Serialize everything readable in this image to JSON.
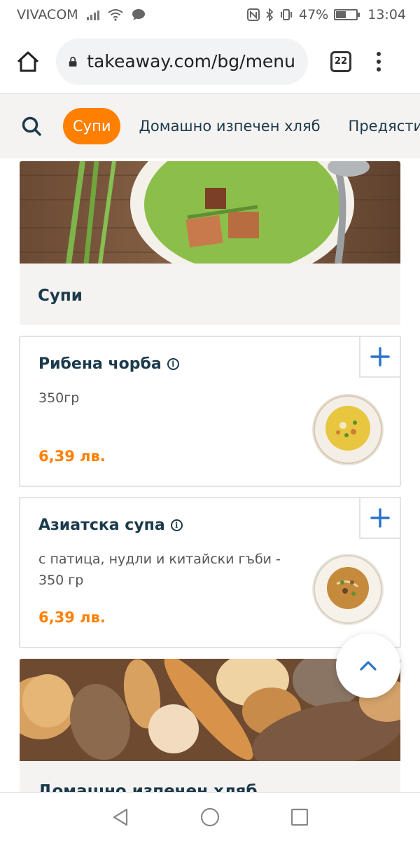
{
  "status_bar": {
    "carrier": "VIVACOM",
    "battery_percent_text": "47%",
    "battery_level": 0.47,
    "time": "13:04"
  },
  "browser": {
    "url": "takeaway.com/bg/menu",
    "tab_count": "22"
  },
  "category_nav": {
    "active": "Супи",
    "items": [
      "Домашно изпечен хляб",
      "Предястия"
    ]
  },
  "section_soups": {
    "title": "Супи"
  },
  "items": [
    {
      "name": "Рибена чорба",
      "description": "350гр",
      "price": "6,39 лв."
    },
    {
      "name": "Азиатска супа",
      "description": "с патица, нудли и китайски гъби - 350 гр",
      "price": "6,39 лв."
    }
  ],
  "section_bread": {
    "title": "Домашно изпечен хляб"
  },
  "colors": {
    "accent": "#ff8000",
    "text_dark": "#1b3a4b",
    "add_icon": "#2a73c9",
    "panel_bg": "#f5f3f1"
  },
  "icons": [
    "home-icon",
    "lock-icon",
    "search-icon",
    "plus-icon",
    "info-icon",
    "chevron-up-icon",
    "back-icon",
    "home-circle-icon",
    "recents-icon"
  ]
}
